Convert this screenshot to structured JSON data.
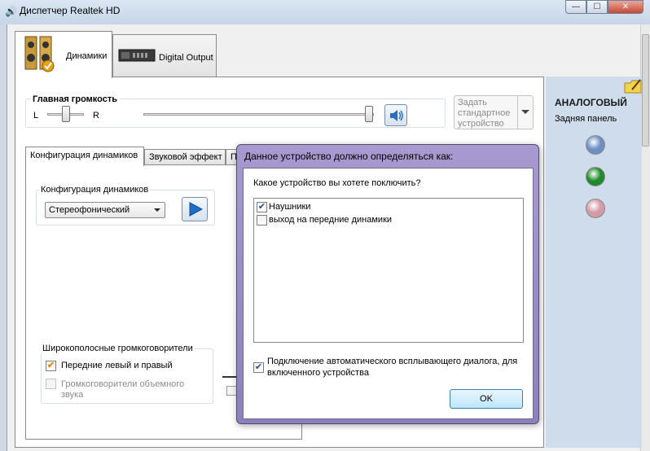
{
  "window": {
    "title": "Диспетчер Realtek HD",
    "min_glyph": "—",
    "max_glyph": "☐",
    "close_glyph": "✕"
  },
  "tabs": [
    {
      "label": "Динамики",
      "icon": "speaker-icon"
    },
    {
      "label": "Digital Output",
      "icon": "digital-output-icon"
    }
  ],
  "volume": {
    "title": "Главная громкость",
    "left_label": "L",
    "right_label": "R",
    "balance": 0.5,
    "level": 1.0,
    "icon": "speaker-volume-icon"
  },
  "default_device": {
    "label_line1": "Задать",
    "label_line2": "стандартное",
    "label_line3": "устройство"
  },
  "sub_tabs": [
    "Конфигурация динамиков",
    "Звуковой эффект",
    "П"
  ],
  "speaker_config": {
    "group_title": "Конфигурация динамиков",
    "selected": "Стереофонический",
    "play_icon": "play-icon"
  },
  "wideband": {
    "group_title": "Широкополосные громкоговорители",
    "item1": "Передние левый и правый",
    "item1_checked": true,
    "item2_line1": "Громкоговорители объемного",
    "item2_line2": "звука",
    "item2_checked": false
  },
  "right_panel": {
    "title": "АНАЛОГОВЫЙ",
    "subtitle": "Задняя панель",
    "jacks": [
      {
        "color": "#6e8fc4",
        "name": "blue-jack"
      },
      {
        "color": "#1f8a2a",
        "name": "green-jack"
      },
      {
        "color": "#d49aa6",
        "name": "pink-jack"
      }
    ]
  },
  "dialog": {
    "title": "Данное устройство должно определяться как:",
    "question": "Какое устройство вы хотете поключить?",
    "options": [
      {
        "label": "Наушники",
        "checked": true
      },
      {
        "label": "выход на передние динамики",
        "checked": false
      }
    ],
    "auto_popup_line1": "Подключение автоматического всплывающего диалога, для",
    "auto_popup_line2": "включенного устройства",
    "auto_popup_checked": true,
    "ok_label": "OK"
  },
  "colors": {
    "dialog_frame": "#9a8cc8",
    "accent_blue": "#2a6fc4",
    "check_orange": "#e88a00"
  }
}
